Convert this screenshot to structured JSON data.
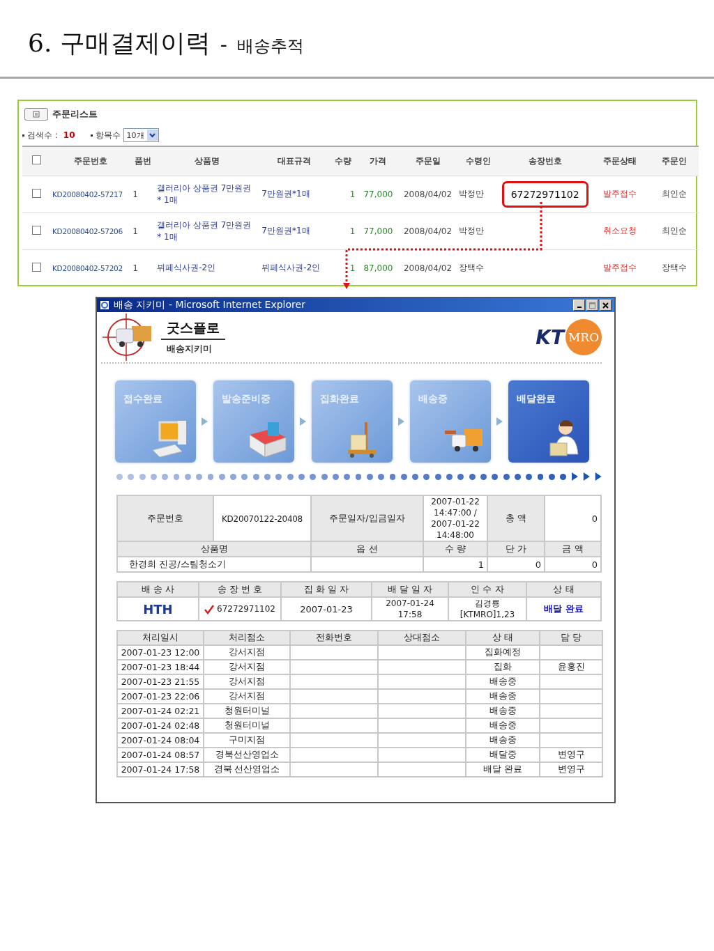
{
  "page_title": {
    "main": "6. 구매결제이력",
    "separator": "-",
    "sub": "배송추적"
  },
  "order_list": {
    "title": "주문리스트",
    "search_count_label": "검색수 :",
    "search_count": "10",
    "items_label": "항목수",
    "items_select": "10개",
    "columns": [
      "주문번호",
      "품번",
      "상품명",
      "대표규격",
      "수량",
      "가격",
      "주문일",
      "수령인",
      "송장번호",
      "주문상태",
      "주문인"
    ],
    "header_checked": false,
    "rows": [
      {
        "checked": false,
        "order_no": "KD20080402-57217",
        "item_no": "1",
        "product": "갤러리아 상품권 7만원권 * 1매",
        "spec": "7만원권*1매",
        "qty": "1",
        "price": "77,000",
        "date": "2008/04/02",
        "recipient": "박정만",
        "invoice": "67272971102",
        "status": "발주접수",
        "orderer": "최인순"
      },
      {
        "checked": false,
        "order_no": "KD20080402-57206",
        "item_no": "1",
        "product": "갤러리아 상품권 7만원권 * 1매",
        "spec": "7만원권*1매",
        "qty": "1",
        "price": "77,000",
        "date": "2008/04/02",
        "recipient": "박정만",
        "status": "취소요청",
        "orderer": "최인순"
      },
      {
        "checked": false,
        "order_no": "KD20080402-57202",
        "item_no": "1",
        "product": "뷔페식사권-2인",
        "spec": "뷔페식사권-2인",
        "qty": "1",
        "price": "87,000",
        "date": "2008/04/02",
        "recipient": "장택수",
        "status": "발주접수",
        "orderer": "장택수"
      }
    ]
  },
  "popup": {
    "window_title": "배송 지키미 - Microsoft Internet Explorer",
    "brand": {
      "name": "굿스플로",
      "sub": "배송지키미"
    },
    "logo": {
      "left": "KT",
      "right": "MRO"
    },
    "steps": [
      {
        "label": "접수완료",
        "kind": "computer",
        "selected": false
      },
      {
        "label": "발송준비중",
        "kind": "box",
        "selected": false
      },
      {
        "label": "집화완료",
        "kind": "cart",
        "selected": false
      },
      {
        "label": "배송중",
        "kind": "truck",
        "selected": false
      },
      {
        "label": "배달완료",
        "kind": "person",
        "selected": true
      }
    ],
    "order_info": {
      "order_no_label": "주문번호",
      "order_no": "KD20070122-20408",
      "date_label": "주문일자/입금일자",
      "date": "2007-01-22 14:47:00 / 2007-01-22 14:48:00",
      "total_label": "총 액",
      "total": "0",
      "item_columns": [
        "상품명",
        "옵 션",
        "수 량",
        "단 가",
        "금 액"
      ],
      "item_row": {
        "product": "한경희 진공/스팀청소기",
        "qty": "1",
        "unit_price": "0",
        "amount": "0"
      }
    },
    "shipment": {
      "columns": [
        "배 송 사",
        "송 장 번 호",
        "집 화 일 자",
        "배 달 일 자",
        "인 수 자",
        "상 태"
      ],
      "carrier_logo": "HTH",
      "invoice_checked": true,
      "invoice": "67272971102",
      "pickup_date": "2007-01-23",
      "delivery_date": "2007-01-24 17:58",
      "receiver": "김경룡 [KTMRO]1,23",
      "status": "배달 완료"
    },
    "history": {
      "columns": [
        "처리일시",
        "처리점소",
        "전화번호",
        "상대점소",
        "상 태",
        "담 당"
      ],
      "rows": [
        [
          "2007-01-23 12:00",
          "강서지점",
          "",
          "",
          "집화예정",
          ""
        ],
        [
          "2007-01-23 18:44",
          "강서지점",
          "",
          "",
          "집화",
          "윤홍진"
        ],
        [
          "2007-01-23 21:55",
          "강서지점",
          "",
          "",
          "배송중",
          ""
        ],
        [
          "2007-01-23 22:06",
          "강서지점",
          "",
          "",
          "배송중",
          ""
        ],
        [
          "2007-01-24 02:21",
          "청원터미널",
          "",
          "",
          "배송중",
          ""
        ],
        [
          "2007-01-24 02:48",
          "청원터미널",
          "",
          "",
          "배송중",
          ""
        ],
        [
          "2007-01-24 08:04",
          "구미지점",
          "",
          "",
          "배송중",
          ""
        ],
        [
          "2007-01-24 08:57",
          "경북선산영업소",
          "",
          "",
          "배달중",
          "변영구"
        ],
        [
          "2007-01-24 17:58",
          "경북 선산영업소",
          "",
          "",
          "배달 완료",
          "변영구"
        ]
      ]
    }
  }
}
